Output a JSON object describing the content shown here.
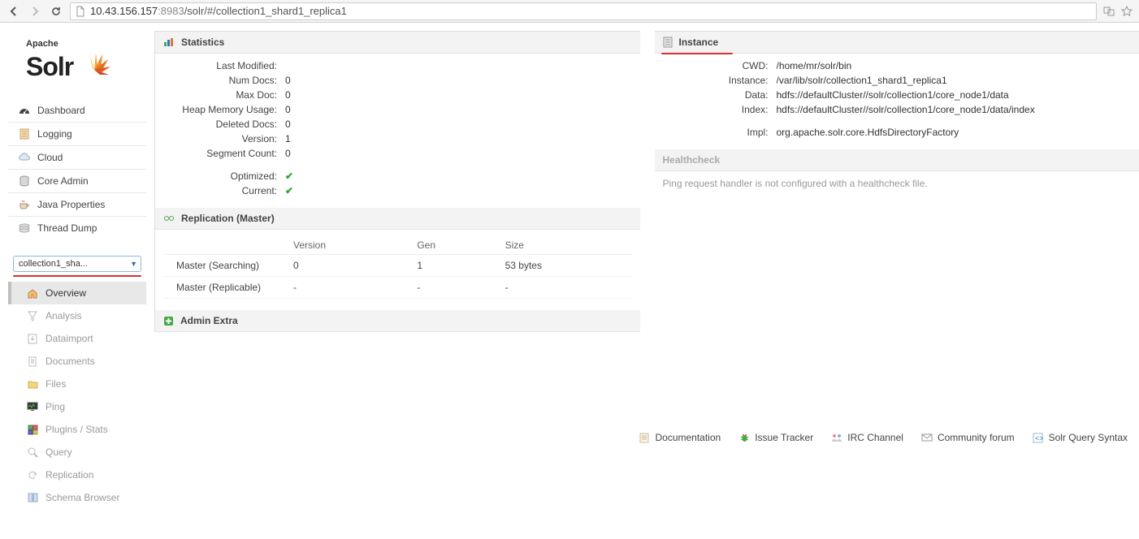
{
  "browser": {
    "url_host": "10.43.156.157",
    "url_port": ":8983",
    "url_path": "/solr/#/collection1_shard1_replica1"
  },
  "logo": {
    "apache": "Apache",
    "solr": "Solr"
  },
  "nav": {
    "dashboard": "Dashboard",
    "logging": "Logging",
    "cloud": "Cloud",
    "coreadmin": "Core Admin",
    "javaprops": "Java Properties",
    "threaddump": "Thread Dump"
  },
  "core_select": {
    "label": "collection1_sha..."
  },
  "subnav": {
    "overview": "Overview",
    "analysis": "Analysis",
    "dataimport": "Dataimport",
    "documents": "Documents",
    "files": "Files",
    "ping": "Ping",
    "plugins": "Plugins / Stats",
    "query": "Query",
    "replication": "Replication",
    "schema": "Schema Browser"
  },
  "stats": {
    "title": "Statistics",
    "labels": {
      "lastmod": "Last Modified:",
      "numdocs": "Num Docs:",
      "maxdoc": "Max Doc:",
      "heap": "Heap Memory Usage:",
      "deleted": "Deleted Docs:",
      "version": "Version:",
      "segcount": "Segment Count:",
      "optimized": "Optimized:",
      "current": "Current:"
    },
    "values": {
      "lastmod": "",
      "numdocs": "0",
      "maxdoc": "0",
      "heap": "0",
      "deleted": "0",
      "version": "1",
      "segcount": "0"
    }
  },
  "replication": {
    "title": "Replication (Master)",
    "headers": {
      "version": "Version",
      "gen": "Gen",
      "size": "Size"
    },
    "rows": [
      {
        "label": "Master (Searching)",
        "version": "0",
        "gen": "1",
        "size": "53 bytes"
      },
      {
        "label": "Master (Replicable)",
        "version": "-",
        "gen": "-",
        "size": "-"
      }
    ]
  },
  "adminextra": {
    "title": "Admin Extra"
  },
  "instance": {
    "title": "Instance",
    "labels": {
      "cwd": "CWD:",
      "instance": "Instance:",
      "data": "Data:",
      "index": "Index:",
      "impl": "Impl:"
    },
    "values": {
      "cwd": "/home/mr/solr/bin",
      "instance": "/var/lib/solr/collection1_shard1_replica1",
      "data": "hdfs://defaultCluster//solr/collection1/core_node1/data",
      "index": "hdfs://defaultCluster//solr/collection1/core_node1/data/index",
      "impl": "org.apache.solr.core.HdfsDirectoryFactory"
    }
  },
  "healthcheck": {
    "title": "Healthcheck",
    "note": "Ping request handler is not configured with a healthcheck file."
  },
  "footer": {
    "doc": "Documentation",
    "issue": "Issue Tracker",
    "irc": "IRC Channel",
    "forum": "Community forum",
    "sqs": "Solr Query Syntax"
  }
}
